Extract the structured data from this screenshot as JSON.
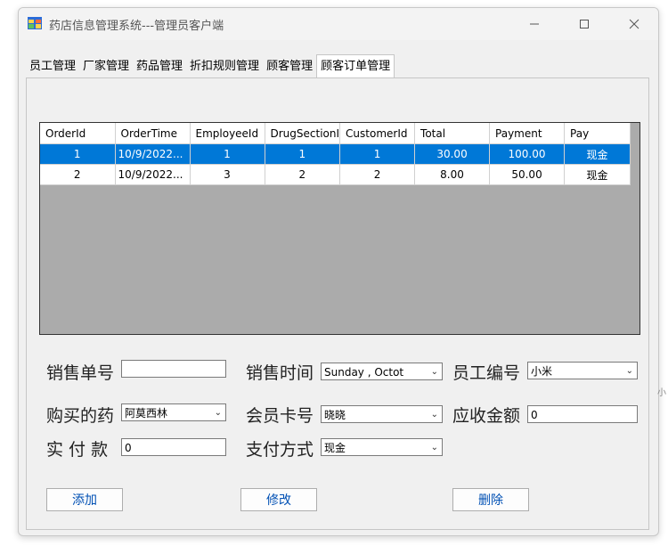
{
  "window": {
    "title": "药店信息管理系统---管理员客户端"
  },
  "tabs": [
    "员工管理",
    "厂家管理",
    "药品管理",
    "折扣规则管理",
    "顾客管理",
    "顾客订单管理"
  ],
  "grid": {
    "columns": [
      "OrderId",
      "OrderTime",
      "EmployeeId",
      "DrugSectionI",
      "CustomerId",
      "Total",
      "Payment",
      "Pay"
    ],
    "rows": [
      {
        "OrderId": "1",
        "OrderTime": "10/9/2022...",
        "EmployeeId": "1",
        "DrugSectionId": "1",
        "CustomerId": "1",
        "Total": "30.00",
        "Payment": "100.00",
        "Pay": "现金",
        "selected": true
      },
      {
        "OrderId": "2",
        "OrderTime": "10/9/2022...",
        "EmployeeId": "3",
        "DrugSectionId": "2",
        "CustomerId": "2",
        "Total": "8.00",
        "Payment": "50.00",
        "Pay": "现金",
        "selected": false
      }
    ]
  },
  "form": {
    "order_no_label": "销售单号",
    "order_no_value": "",
    "sale_time_label": "销售时间",
    "sale_time_value": "Sunday  ,  Octot",
    "employee_no_label": "员工编号",
    "employee_no_value": "小米",
    "drug_label": "购买的药",
    "drug_value": "阿莫西林",
    "member_card_label": "会员卡号",
    "member_card_value": "晓晓",
    "receivable_label": "应收金额",
    "receivable_value": "0",
    "paid_label": "实 付 款",
    "paid_value": "0",
    "pay_method_label": "支付方式",
    "pay_method_value": "现金"
  },
  "buttons": {
    "add": "添加",
    "modify": "修改",
    "delete": "删除"
  },
  "side_fragment": "小"
}
